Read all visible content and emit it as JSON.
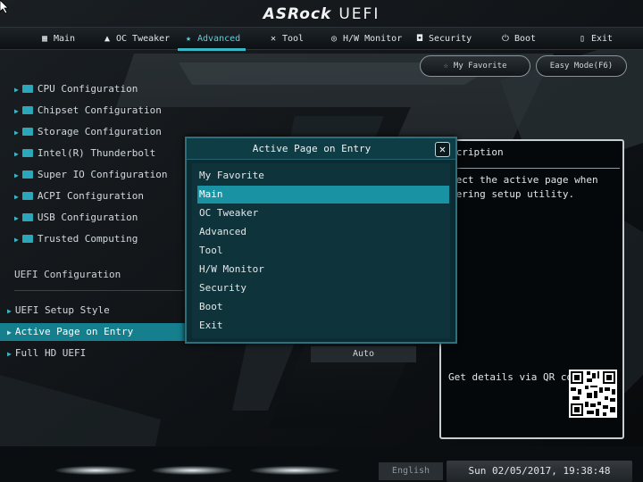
{
  "brand": {
    "name": "ASRock",
    "product": "UEFI"
  },
  "nav": {
    "tabs": [
      {
        "label": "Main",
        "icon": "grid-icon"
      },
      {
        "label": "OC Tweaker",
        "icon": "rocket-icon"
      },
      {
        "label": "Advanced",
        "icon": "star-icon",
        "active": true
      },
      {
        "label": "Tool",
        "icon": "tools-icon"
      },
      {
        "label": "H/W Monitor",
        "icon": "monitor-gauge-icon"
      },
      {
        "label": "Security",
        "icon": "shield-icon"
      },
      {
        "label": "Boot",
        "icon": "power-icon"
      },
      {
        "label": "Exit",
        "icon": "exit-door-icon"
      }
    ],
    "my_favorite": "My Favorite",
    "easy_mode": "Easy Mode(F6)"
  },
  "menu": {
    "items": [
      "CPU Configuration",
      "Chipset Configuration",
      "Storage Configuration",
      "Intel(R) Thunderbolt",
      "Super IO Configuration",
      "ACPI Configuration",
      "USB Configuration",
      "Trusted Computing"
    ],
    "section_label": "UEFI Configuration",
    "settings": [
      {
        "label": "UEFI Setup Style",
        "value": ""
      },
      {
        "label": "Active Page on Entry",
        "value": ""
      },
      {
        "label": "Full HD UEFI",
        "value": "Auto"
      }
    ]
  },
  "description": {
    "title": "scription",
    "text": "lect the active page when\ntering setup utility.",
    "qr_label": "Get details via QR code"
  },
  "dialog": {
    "title": "Active Page on Entry",
    "options": [
      "My Favorite",
      "Main",
      "OC Tweaker",
      "Advanced",
      "Tool",
      "H/W Monitor",
      "Security",
      "Boot",
      "Exit"
    ],
    "selected": "Main"
  },
  "status": {
    "language": "English",
    "datetime": "Sun 02/05/2017, 19:38:48"
  },
  "colors": {
    "accent": "#3ab8c6",
    "highlight": "#157f8e",
    "dialog_bg": "#0c2c33",
    "dialog_selected": "#1993a3"
  }
}
